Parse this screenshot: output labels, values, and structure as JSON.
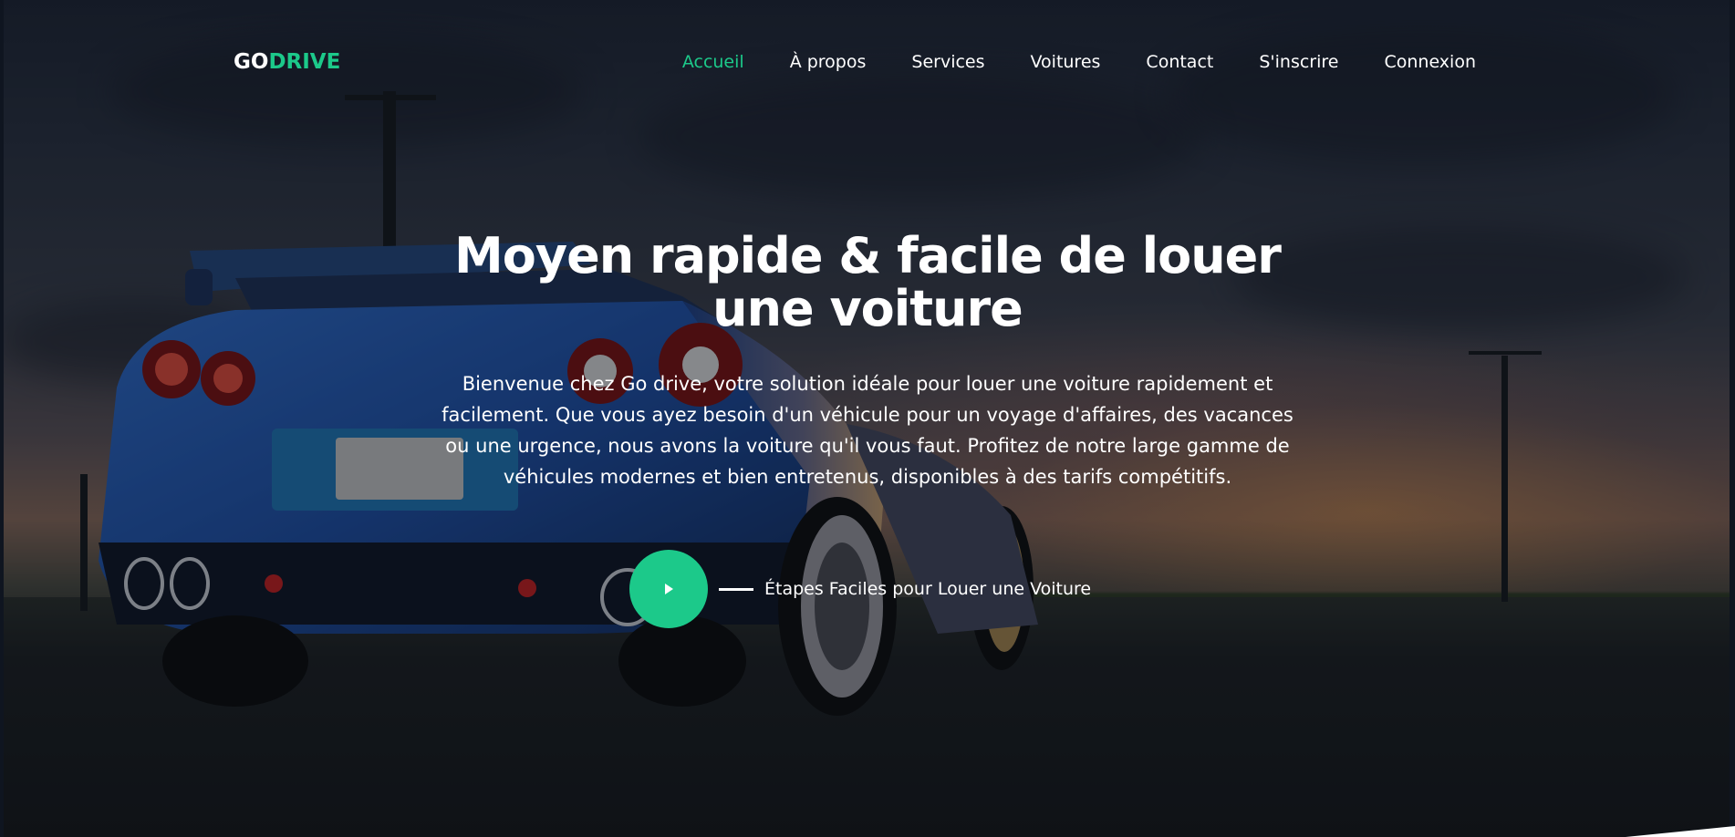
{
  "brand": {
    "logo_part1": "GO",
    "logo_part2": "DRIVE"
  },
  "nav": {
    "items": [
      {
        "label": "Accueil",
        "active": true
      },
      {
        "label": "À propos",
        "active": false
      },
      {
        "label": "Services",
        "active": false
      },
      {
        "label": "Voitures",
        "active": false
      },
      {
        "label": "Contact",
        "active": false
      },
      {
        "label": "S'inscrire",
        "active": false
      },
      {
        "label": "Connexion",
        "active": false
      }
    ]
  },
  "hero": {
    "title_line1": "Moyen rapide & facile de louer",
    "title_line2": "une voiture",
    "description": "Bienvenue chez Go drive, votre solution idéale pour louer une voiture rapidement et facilement. Que vous ayez besoin d'un véhicule pour un voyage d'affaires, des vacances ou une urgence, nous avons la voiture qu'il vous faut. Profitez de notre large gamme de véhicules modernes et bien entretenus, disponibles à des tarifs compétitifs.",
    "steps_label": "Étapes Faciles pour Louer une Voiture",
    "play_icon": "play-icon"
  },
  "colors": {
    "accent": "#1cc98a",
    "text": "#ffffff",
    "overlay": "#0a0e16"
  }
}
